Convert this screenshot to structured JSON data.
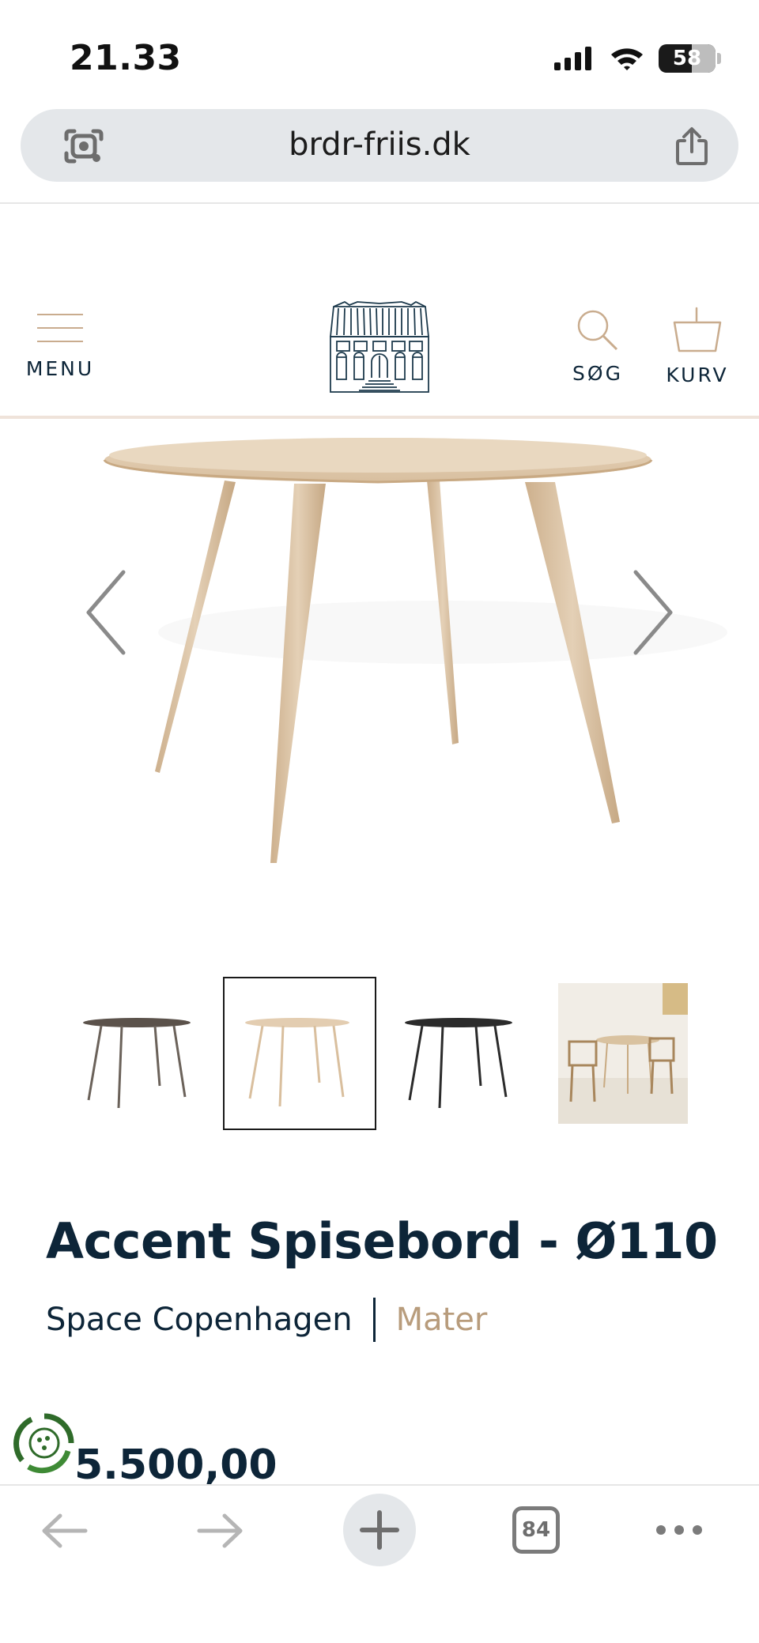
{
  "status_bar": {
    "time": "21.33",
    "battery": "58"
  },
  "browser": {
    "url": "brdr-friis.dk",
    "tab_count": "84"
  },
  "header": {
    "menu_label": "MENU",
    "search_label": "SØG",
    "cart_label": "KURV"
  },
  "product": {
    "title": "Accent Spisebord - Ø110",
    "designer": "Space Copenhagen",
    "brand": "Mater",
    "price": "5.500,00"
  },
  "gallery": {
    "thumbnails": [
      "smoked-oak",
      "natural-oak",
      "black-oak",
      "dining-room"
    ],
    "active_index": 1
  },
  "colors": {
    "navy": "#0d2538",
    "tan": "#b89c7c",
    "oak": "#dcc3a4"
  }
}
